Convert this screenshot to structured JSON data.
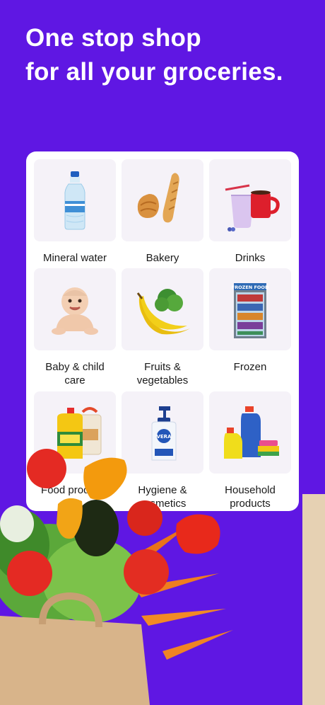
{
  "headline": {
    "line1": "One stop shop",
    "line2": "for all your groceries."
  },
  "categories": [
    {
      "label": "Mineral water",
      "icon": "water-bottle-icon"
    },
    {
      "label": "Bakery",
      "icon": "bread-icon"
    },
    {
      "label": "Drinks",
      "icon": "drinks-icon"
    },
    {
      "label": "Baby & child care",
      "icon": "baby-icon"
    },
    {
      "label": "Fruits & vegetables",
      "icon": "banana-icon"
    },
    {
      "label": "Frozen",
      "icon": "freezer-icon"
    },
    {
      "label": "Food products",
      "icon": "oil-bottle-icon"
    },
    {
      "label": "Hygiene & cosmetics",
      "icon": "soap-bottle-icon"
    },
    {
      "label": "Household products",
      "icon": "detergent-icon"
    }
  ],
  "frozen_sign": "FROZEN FOOD",
  "soap_brand": "VERA",
  "colors": {
    "background": "#5f17e3",
    "card": "#ffffff",
    "tile": "#f5f2f8"
  }
}
